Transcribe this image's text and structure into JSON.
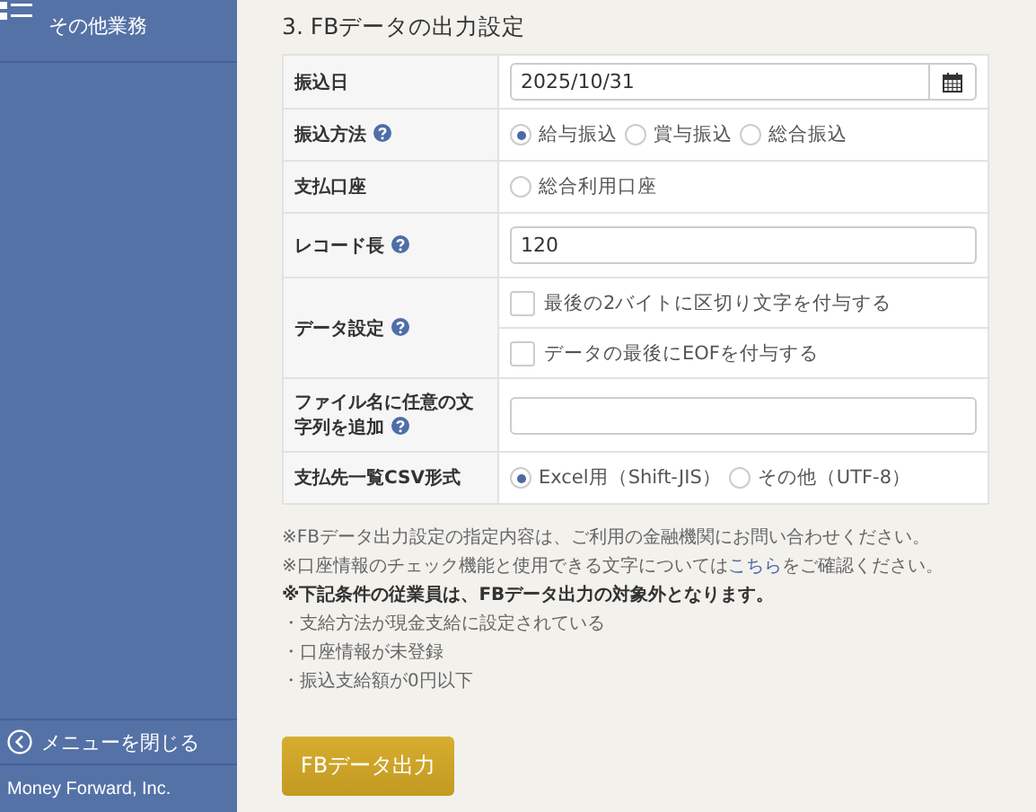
{
  "sidebar": {
    "items": [
      {
        "label": "その他業務"
      }
    ],
    "close_menu": "メニューを閉じる",
    "footer": "Money Forward, Inc."
  },
  "section": {
    "title": "3. FBデータの出力設定"
  },
  "form": {
    "rows": [
      {
        "label": "振込日",
        "help": false,
        "kind": "date",
        "value": "2025/10/31"
      },
      {
        "label": "振込方法",
        "help": true,
        "kind": "radio",
        "options": [
          {
            "label": "給与振込",
            "selected": true
          },
          {
            "label": "賞与振込",
            "selected": false
          },
          {
            "label": "総合振込",
            "selected": false
          }
        ]
      },
      {
        "label": "支払口座",
        "help": false,
        "kind": "radio",
        "options": [
          {
            "label": "総合利用口座",
            "selected": false
          }
        ]
      },
      {
        "label": "レコード長",
        "help": true,
        "kind": "text",
        "value": "120"
      },
      {
        "label": "データ設定",
        "help": true,
        "kind": "checkbox",
        "options": [
          {
            "label": "最後の2バイトに区切り文字を付与する",
            "checked": false
          },
          {
            "label": "データの最後にEOFを付与する",
            "checked": false
          }
        ]
      },
      {
        "label": "ファイル名に任意の文字列を追加",
        "help": true,
        "kind": "text"
      },
      {
        "label": "支払先一覧CSV形式",
        "help": false,
        "kind": "radio",
        "options": [
          {
            "label": "Excel用（Shift-JIS）",
            "selected": true
          },
          {
            "label": "その他（UTF-8）",
            "selected": false
          }
        ]
      }
    ]
  },
  "notes": [
    {
      "kind": "plain",
      "text": "※FBデータ出力設定の指定内容は、ご利用の金融機関にお問い合わせください。"
    },
    {
      "kind": "link",
      "before": "※口座情報のチェック機能と使用できる文字については",
      "link": "こちら",
      "after": "をご確認ください。"
    },
    {
      "kind": "bold",
      "text": "※下記条件の従業員は、FBデータ出力の対象外となります。"
    },
    {
      "kind": "plain",
      "text": "・支給方法が現金支給に設定されている"
    },
    {
      "kind": "plain",
      "text": "・口座情報が未登録"
    },
    {
      "kind": "plain",
      "text": "・振込支給額が0円以下"
    }
  ],
  "button": "FBデータ出力"
}
